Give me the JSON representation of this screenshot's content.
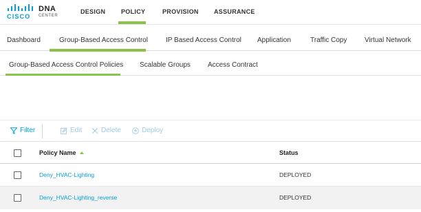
{
  "brand": {
    "company": "CISCO",
    "product": "DNA",
    "product_sub": "CENTER",
    "accent_color": "#8bc34a",
    "link_color": "#049fd9"
  },
  "topnav": {
    "items": [
      "DESIGN",
      "POLICY",
      "PROVISION",
      "ASSURANCE"
    ],
    "active": "POLICY"
  },
  "policy_tabs": {
    "items": [
      "Dashboard",
      "Group-Based Access Control",
      "IP Based Access Control",
      "Application",
      "Traffic Copy",
      "Virtual Network"
    ],
    "active": "Group-Based Access Control"
  },
  "sub_tabs": {
    "items": [
      "Group-Based Access Control Policies",
      "Scalable Groups",
      "Access Contract"
    ],
    "active": "Group-Based Access Control Policies"
  },
  "toolbar": {
    "filter": "Filter",
    "edit": "Edit",
    "delete": "Delete",
    "deploy": "Deploy"
  },
  "table": {
    "columns": {
      "name": "Policy Name",
      "status": "Status"
    },
    "rows": [
      {
        "name": "Deny_HVAC-Lighting",
        "status": "DEPLOYED"
      },
      {
        "name": "Deny_HVAC-Lighting_reverse",
        "status": "DEPLOYED"
      }
    ]
  }
}
